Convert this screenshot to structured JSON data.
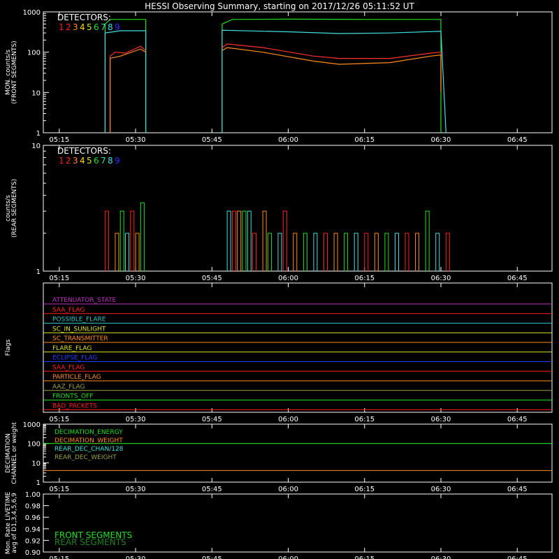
{
  "title": "HESSI Observing Summary, starting on 2017/12/26 05:11:52 UT",
  "colors": {
    "det": [
      "#ff2020",
      "#ff2020",
      "#ff8c1a",
      "#ffd700",
      "#c8e020",
      "#20e020",
      "#20e0a0",
      "#40e0e0",
      "#3030ff"
    ],
    "line1": "#ff3030",
    "line3": "#ff8c1a",
    "line6": "#20e020",
    "line8": "#40e0e0",
    "line9": "#3030ff",
    "axis": "#ffffff"
  },
  "time_ticks": [
    "05:15",
    "05:30",
    "05:45",
    "06:00",
    "06:15",
    "06:30",
    "06:45"
  ],
  "chart_data": [
    {
      "type": "line",
      "ylabel": "MON. counts/s\n(FRONT SEGMENTS)",
      "yscale": "log",
      "ylim": [
        1,
        1000
      ],
      "y_ticks": [
        "1",
        "10",
        "100",
        "1000"
      ],
      "legend_title": "DETECTORS:",
      "legend_numbers": [
        "1",
        "2",
        "3",
        "4",
        "5",
        "6",
        "7",
        "8",
        "9"
      ],
      "series": [
        {
          "name": "6",
          "color_key": "line6",
          "segments": [
            [
              [
                "05:24",
                1
              ],
              [
                "05:24",
                500
              ],
              [
                "05:25",
                650
              ],
              [
                "05:32",
                650
              ],
              [
                "05:32",
                1
              ]
            ],
            [
              [
                "05:47",
                1
              ],
              [
                "05:47",
                500
              ],
              [
                "05:49",
                650
              ],
              [
                "06:00",
                660
              ],
              [
                "06:15",
                650
              ],
              [
                "06:30",
                650
              ],
              [
                "06:30",
                1
              ]
            ]
          ]
        },
        {
          "name": "8",
          "color_key": "line8",
          "segments": [
            [
              [
                "05:24",
                1
              ],
              [
                "05:24",
                300
              ],
              [
                "05:27",
                340
              ],
              [
                "05:32",
                340
              ],
              [
                "05:32",
                1
              ]
            ],
            [
              [
                "05:47",
                1
              ],
              [
                "05:47",
                350
              ],
              [
                "06:00",
                320
              ],
              [
                "06:10",
                290
              ],
              [
                "06:20",
                300
              ],
              [
                "06:30",
                330
              ],
              [
                "06:31",
                1
              ]
            ]
          ]
        },
        {
          "name": "1",
          "color_key": "line1",
          "segments": [
            [
              [
                "05:25",
                1
              ],
              [
                "05:25",
                80
              ],
              [
                "05:26",
                100
              ],
              [
                "05:28",
                95
              ],
              [
                "05:31",
                140
              ],
              [
                "05:32",
                110
              ]
            ],
            [
              [
                "05:47",
                130
              ],
              [
                "05:48",
                160
              ],
              [
                "05:55",
                130
              ],
              [
                "06:05",
                80
              ],
              [
                "06:10",
                70
              ],
              [
                "06:20",
                70
              ],
              [
                "06:28",
                95
              ],
              [
                "06:30",
                100
              ],
              [
                "06:30",
                15
              ]
            ]
          ]
        },
        {
          "name": "3",
          "color_key": "line3",
          "segments": [
            [
              [
                "05:25",
                1
              ],
              [
                "05:25",
                70
              ],
              [
                "05:27",
                80
              ],
              [
                "05:31",
                120
              ],
              [
                "05:32",
                100
              ]
            ],
            [
              [
                "05:47",
                110
              ],
              [
                "05:48",
                130
              ],
              [
                "05:55",
                100
              ],
              [
                "06:05",
                60
              ],
              [
                "06:10",
                50
              ],
              [
                "06:20",
                55
              ],
              [
                "06:28",
                80
              ],
              [
                "06:30",
                85
              ],
              [
                "06:30",
                10
              ]
            ]
          ]
        }
      ]
    },
    {
      "type": "line",
      "ylabel": "counts/s\n(REAR SEGMENTS)",
      "yscale": "log",
      "ylim": [
        1,
        10
      ],
      "y_ticks": [
        "1",
        "10"
      ],
      "legend_title": "DETECTORS:",
      "legend_numbers": [
        "1",
        "2",
        "3",
        "4",
        "5",
        "6",
        "7",
        "8",
        "9"
      ],
      "spikes_front": [
        [
          "05:24",
          3
        ],
        [
          "05:26",
          2
        ],
        [
          "05:27",
          3
        ],
        [
          "05:28",
          2
        ],
        [
          "05:29",
          3
        ],
        [
          "05:30",
          2
        ],
        [
          "05:31",
          3.5
        ],
        [
          "05:48",
          3
        ],
        [
          "05:49",
          3
        ],
        [
          "05:50",
          3
        ],
        [
          "05:51",
          3
        ],
        [
          "05:52",
          3
        ],
        [
          "05:53",
          2
        ],
        [
          "05:55",
          3
        ],
        [
          "05:56",
          2
        ],
        [
          "05:58",
          2
        ],
        [
          "05:59",
          3
        ],
        [
          "06:01",
          2
        ],
        [
          "06:03",
          2
        ],
        [
          "06:05",
          2
        ],
        [
          "06:07",
          2
        ],
        [
          "06:09",
          2
        ],
        [
          "06:11",
          2
        ],
        [
          "06:13",
          2
        ],
        [
          "06:15",
          2
        ],
        [
          "06:17",
          2
        ],
        [
          "06:19",
          2
        ],
        [
          "06:21",
          2
        ],
        [
          "06:23",
          2
        ],
        [
          "06:25",
          2
        ],
        [
          "06:27",
          3
        ],
        [
          "06:29",
          2
        ],
        [
          "06:31",
          2
        ]
      ]
    },
    {
      "type": "step",
      "ylabel": "Flags",
      "flags": [
        {
          "label": "ATTENUATOR_STATE",
          "color": "#c030c0"
        },
        {
          "label": "SAA_FLAG",
          "color": "#ff2020"
        },
        {
          "label": "POSSIBLE_FLARE",
          "color": "#30c0c0"
        },
        {
          "label": "SC_IN_SUNLIGHT",
          "color": "#e0e020"
        },
        {
          "label": "SC_TRANSMITTER",
          "color": "#ff8c1a"
        },
        {
          "label": "FLARE_FLAG",
          "color": "#e0e020"
        },
        {
          "label": "ECLIPSE_FLAG",
          "color": "#2040ff"
        },
        {
          "label": "SAA_FLAG",
          "color": "#ff2020"
        },
        {
          "label": "PARTICLE_FLAG",
          "color": "#ff8c1a"
        },
        {
          "label": "AAZ_FLAG",
          "color": "#a0a040"
        },
        {
          "label": "FRONTS_OFF",
          "color": "#20e020"
        },
        {
          "label": "BAD_PACKETS",
          "color": "#ff2020"
        }
      ]
    },
    {
      "type": "line",
      "ylabel": "DECIMATION\nCHANNEL or weight",
      "yscale": "log",
      "ylim": [
        1,
        1000
      ],
      "y_ticks": [
        "1",
        "10",
        "100",
        "1000"
      ],
      "legend": [
        {
          "label": "DECIMATION_ENERGY",
          "color": "#20e020"
        },
        {
          "label": "DECIMATION_WEIGHT",
          "color": "#ff8c1a"
        },
        {
          "label": "REAR_DEC_CHAN/128",
          "color": "#40e0e0"
        },
        {
          "label": "REAR_DEC_WEIGHT",
          "color": "#a0a040"
        }
      ]
    },
    {
      "type": "line",
      "ylabel": "Mon. Rate LIVETIME\navg of D1,3,4,5,6,9",
      "ylim": [
        0.9,
        1.0
      ],
      "y_ticks": [
        "0.90",
        "0.92",
        "0.94",
        "0.96",
        "0.98",
        "1.00"
      ],
      "legend": [
        {
          "label": "FRONT SEGMENTS",
          "color": "#20e020"
        },
        {
          "label": "REAR SEGMENTS",
          "color": "#208020"
        }
      ]
    }
  ]
}
